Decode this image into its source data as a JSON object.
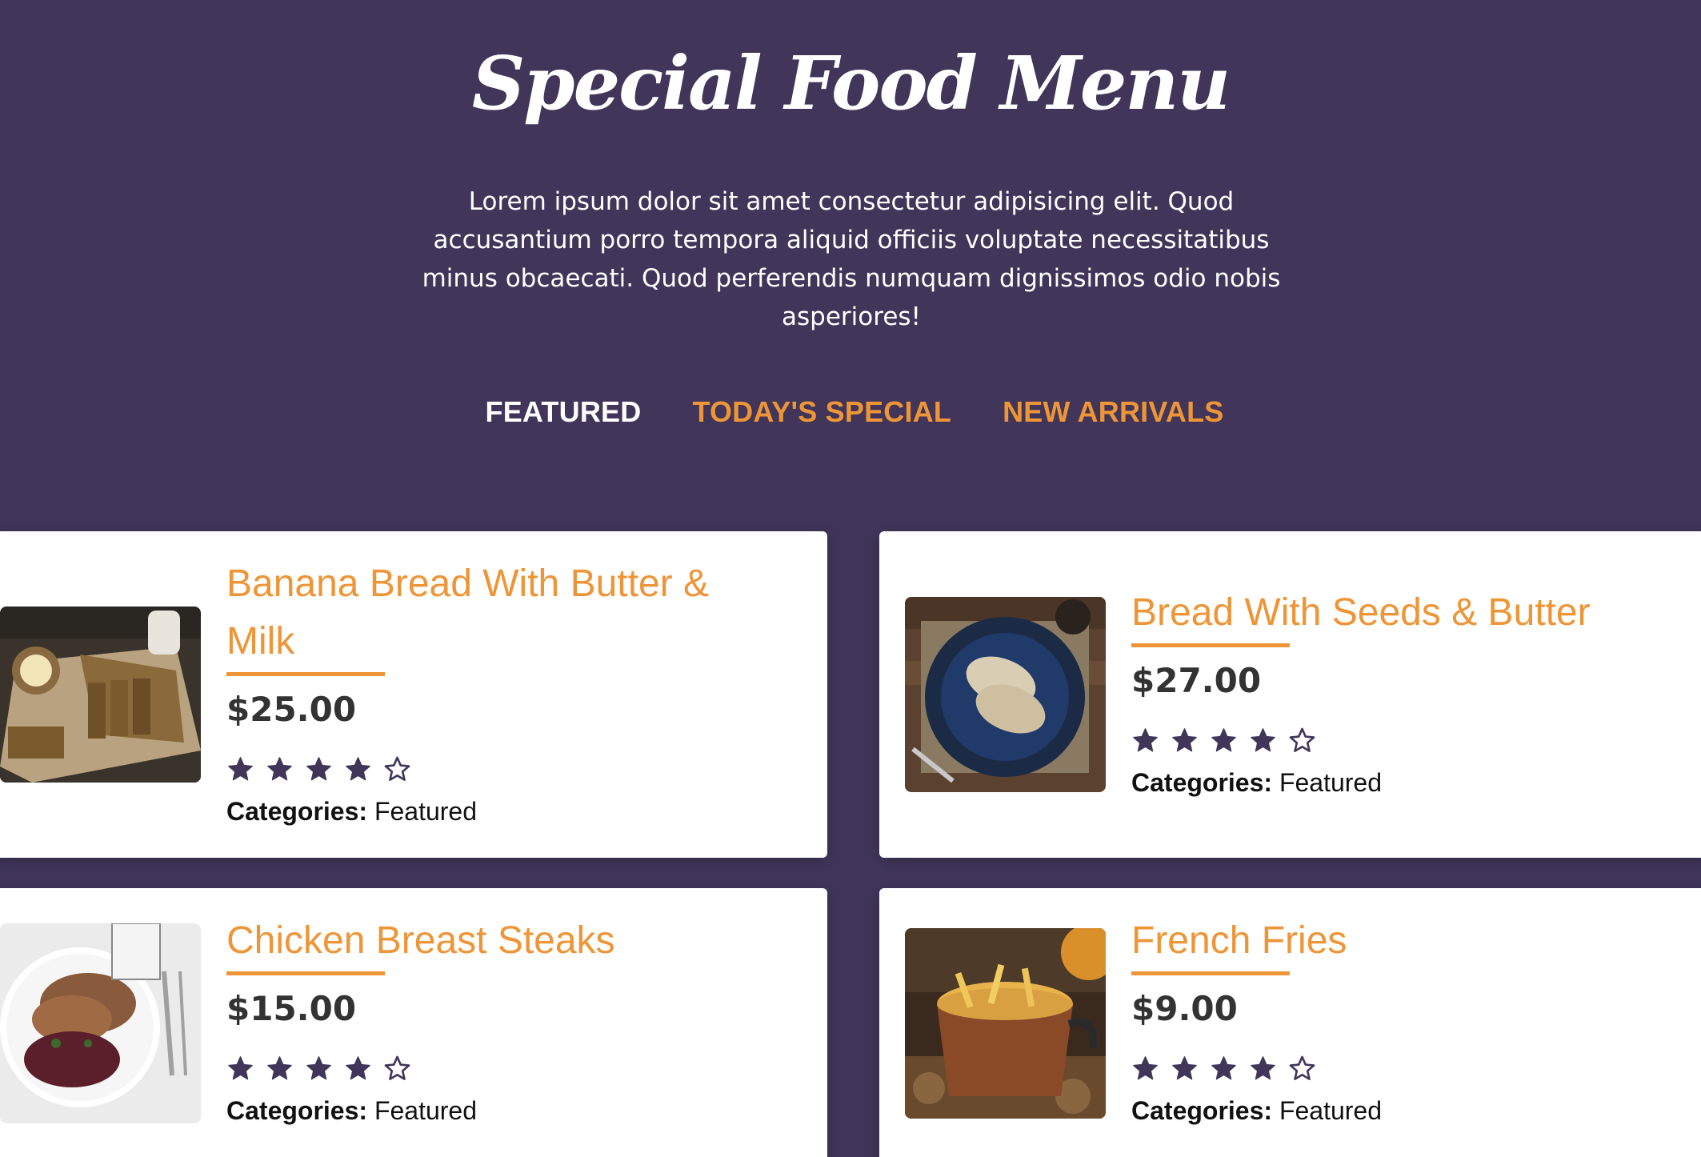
{
  "header": {
    "title": "Special Food Menu",
    "description": "Lorem ipsum dolor sit amet consectetur adipisicing elit. Quod accusantium porro tempora aliquid officiis voluptate necessitatibus minus obcaecati. Quod perferendis numquam dignissimos odio nobis asperiores!"
  },
  "tabs": [
    {
      "label": "FEATURED",
      "active": true
    },
    {
      "label": "TODAY'S SPECIAL",
      "active": false
    },
    {
      "label": "NEW ARRIVALS",
      "active": false
    }
  ],
  "colors": {
    "background": "#41365a",
    "accent": "#ee9537",
    "star": "#41365a",
    "price": "#333333"
  },
  "items": [
    {
      "title": "Banana Bread With Butter & Milk",
      "price": "$25.00",
      "rating": 4,
      "rating_max": 5,
      "categories_label": "Categories:",
      "categories_value": "Featured",
      "image": "banana-bread-photo"
    },
    {
      "title": "Bread With Seeds & Butter",
      "price": "$27.00",
      "rating": 4,
      "rating_max": 5,
      "categories_label": "Categories:",
      "categories_value": "Featured",
      "image": "bread-plate-photo"
    },
    {
      "title": "Chicken Breast Steaks",
      "price": "$15.00",
      "rating": 4,
      "rating_max": 5,
      "categories_label": "Categories:",
      "categories_value": "Featured",
      "image": "chicken-steak-photo"
    },
    {
      "title": "French Fries",
      "price": "$9.00",
      "rating": 4,
      "rating_max": 5,
      "categories_label": "Categories:",
      "categories_value": "Featured",
      "image": "french-fries-photo"
    }
  ]
}
